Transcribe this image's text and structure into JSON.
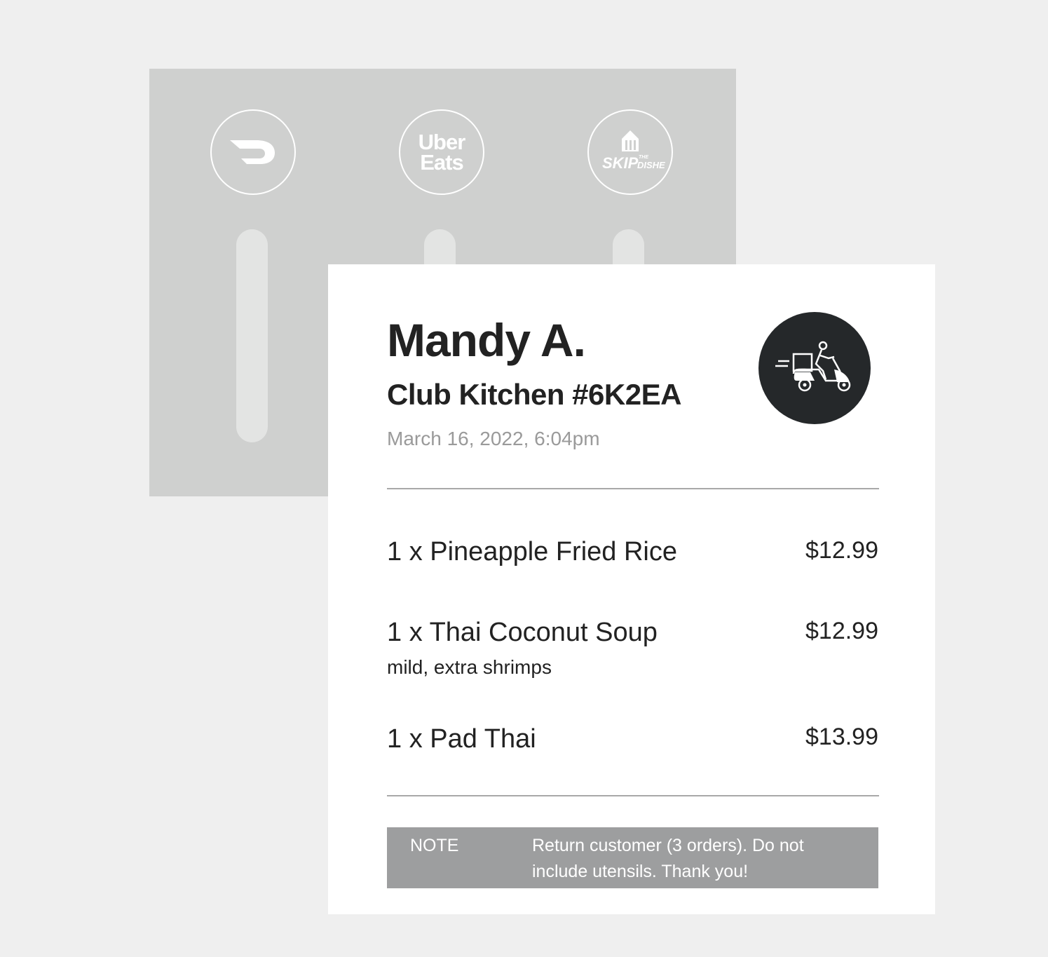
{
  "platforms": [
    {
      "name": "DoorDash",
      "icon": "doordash-logo-icon"
    },
    {
      "name": "Uber Eats",
      "icon": "ubereats-logo-icon",
      "label_line1": "Uber",
      "label_line2": "Eats"
    },
    {
      "name": "SkipTheDishes",
      "icon": "skipthedishes-logo-icon",
      "label_skip": "SKIP",
      "label_the": "THE",
      "label_dishes": "DISHES"
    }
  ],
  "order": {
    "customer_name": "Mandy A.",
    "order_id": "Club Kitchen #6K2EA",
    "timestamp": "March 16, 2022, 6:04pm",
    "delivery_icon": "scooter-delivery-icon",
    "items": [
      {
        "name": "1 x Pineapple Fried Rice",
        "price": "$12.99",
        "modifiers": ""
      },
      {
        "name": "1 x Thai Coconut Soup",
        "price": "$12.99",
        "modifiers": "mild, extra shrimps"
      },
      {
        "name": "1 x Pad Thai",
        "price": "$13.99",
        "modifiers": ""
      }
    ],
    "note_label": "NOTE",
    "note_text": "Return customer (3 orders). Do not include utensils. Thank you!"
  },
  "colors": {
    "background": "#efefef",
    "back_panel": "#cfd0cf",
    "card": "#ffffff",
    "text_primary": "#222222",
    "text_muted": "#9a9a9a",
    "badge": "#25282a",
    "note_bg": "#9d9e9f"
  }
}
